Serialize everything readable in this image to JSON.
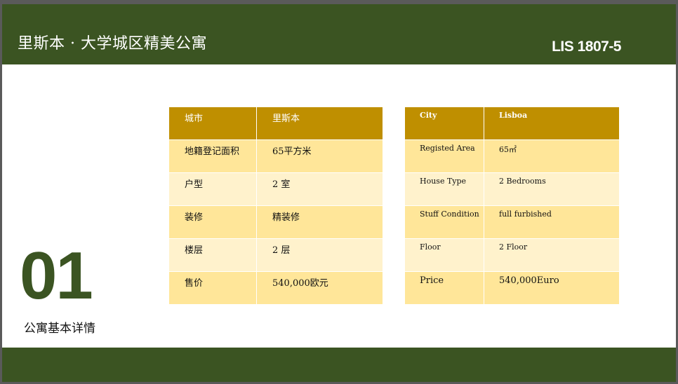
{
  "header": {
    "title": "里斯本 · 大学城区精美公寓",
    "code": "LIS 1807-5"
  },
  "section": {
    "number": "01",
    "label": "公寓基本详情"
  },
  "table_cn": {
    "header": [
      "城市",
      "里斯本"
    ],
    "rows": [
      [
        "地籍登记面积",
        "65平方米"
      ],
      [
        "户型",
        "2 室"
      ],
      [
        "装修",
        "精装修"
      ],
      [
        "楼层",
        "2 层"
      ],
      [
        "售价",
        "540,000欧元"
      ]
    ]
  },
  "table_en": {
    "header": [
      "City",
      "Lisboa"
    ],
    "rows": [
      [
        "Registed Area",
        "65㎡"
      ],
      [
        "House Type",
        "2 Bedrooms"
      ],
      [
        "Stuff Condition",
        "full furbished"
      ],
      [
        "Floor",
        "2  Floor"
      ],
      [
        "Price",
        "540,000Euro"
      ]
    ]
  },
  "colors": {
    "brand_green": "#3b5422",
    "table_header": "#bf8f00",
    "row_dark": "#ffe699",
    "row_light": "#fff2cc"
  }
}
